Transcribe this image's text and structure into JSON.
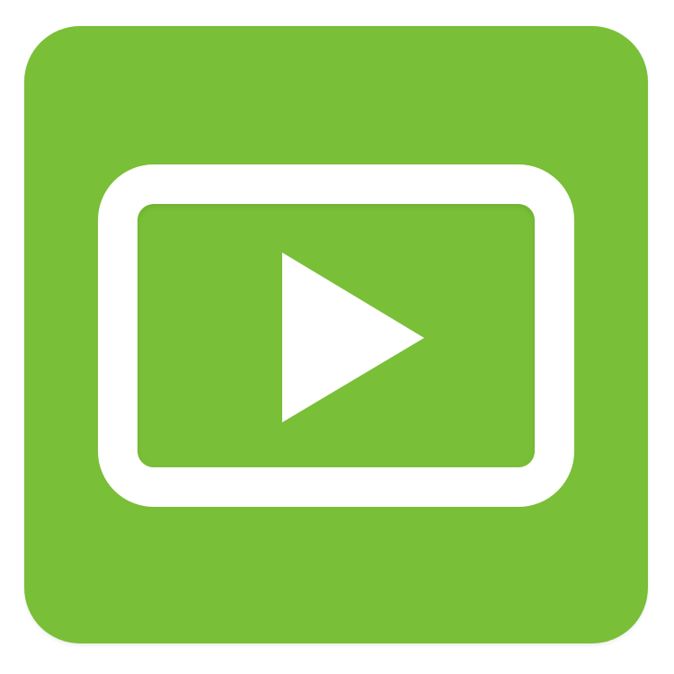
{
  "app_icon": {
    "name": "video-player-app",
    "icon": "play-icon",
    "colors": {
      "background": "#79bf37",
      "foreground": "#ffffff"
    }
  }
}
